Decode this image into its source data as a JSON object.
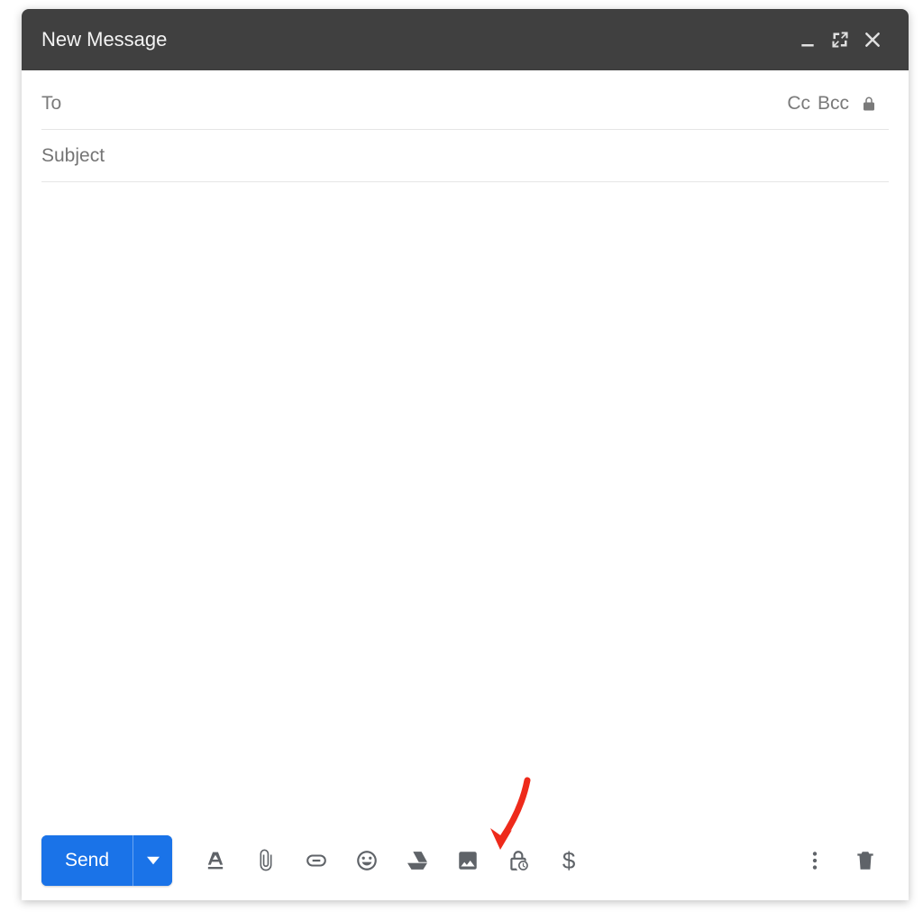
{
  "window": {
    "title": "New Message"
  },
  "fields": {
    "to_label": "To",
    "cc_label": "Cc",
    "bcc_label": "Bcc",
    "subject_placeholder": "Subject"
  },
  "compose": {
    "body": ""
  },
  "toolbar": {
    "send_label": "Send",
    "money_glyph": "$"
  }
}
